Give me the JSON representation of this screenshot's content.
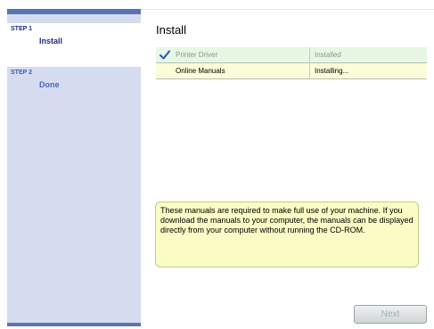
{
  "sidebar": {
    "steps": [
      {
        "label": "STEP 1",
        "name": "Install"
      },
      {
        "label": "STEP 2",
        "name": "Done"
      }
    ]
  },
  "main": {
    "title": "Install",
    "items": [
      {
        "name": "Printer Driver",
        "status": "Installed",
        "icon": "checkmark-icon"
      },
      {
        "name": "Online Manuals",
        "status": "Installing..."
      }
    ],
    "info": "These manuals are required to make full use of your machine. If you download the manuals to your computer, the manuals can be displayed directly from your computer without running the CD-ROM."
  },
  "buttons": {
    "next_label": "Next"
  },
  "colors": {
    "sidebar_accent": "#5a73b6",
    "sidebar_bg": "#d6dcef",
    "installed_row": "#e7f7e3",
    "installing_row": "#fbfdd8",
    "info_box": "#fbfbc5"
  }
}
